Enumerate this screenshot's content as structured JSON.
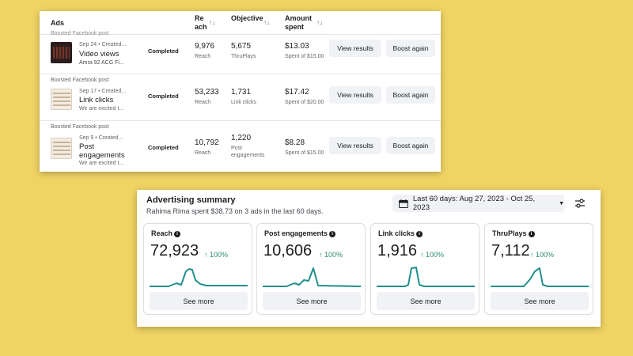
{
  "ads_table": {
    "headers": {
      "ads": "Ads",
      "reach": "Reach",
      "objective": "Objective",
      "amount_spent": "Amount spent"
    },
    "rows": [
      {
        "post_type": "Boosted Facebook post",
        "date": "Sep 24 • Created...",
        "title": "Video views",
        "description": "Amra 92 ACG Fi...",
        "status": "Completed",
        "reach": "9,976",
        "reach_sub": "Reach",
        "objective": "5,675",
        "objective_sub": "ThruPlays",
        "spent": "$13.03",
        "spent_sub": "Spent of $15.00",
        "view_label": "View results",
        "boost_label": "Boost again"
      },
      {
        "post_type": "Boosted Facebook post",
        "date": "Sep 17 • Created...",
        "title": "Link clicks",
        "description": "We are excited t...",
        "status": "Completed",
        "reach": "53,233",
        "reach_sub": "Reach",
        "objective": "1,731",
        "objective_sub": "Link clicks",
        "spent": "$17.42",
        "spent_sub": "Spent of $20.00",
        "view_label": "View results",
        "boost_label": "Boost again"
      },
      {
        "post_type": "Boosted Facebook post",
        "date": "Sep 9 • Created...",
        "title": "Post engagements",
        "description": "We are excited t...",
        "status": "Completed",
        "reach": "10,792",
        "reach_sub": "Reach",
        "objective": "1,220",
        "objective_sub": "Post engagements",
        "spent": "$8.28",
        "spent_sub": "Spent of $15.00",
        "view_label": "View results",
        "boost_label": "Boost again"
      }
    ]
  },
  "summary": {
    "title": "Advertising summary",
    "subtitle": "Rahima Rima spent $38.73 on 3 ads in the last 60 days.",
    "date_range": "Last 60 days: Aug 27, 2023 - Oct 25, 2023",
    "metrics": [
      {
        "label": "Reach",
        "value": "72,923",
        "change": "↑ 100%",
        "see_more": "See more"
      },
      {
        "label": "Post engagements",
        "value": "10,606",
        "change": "↑ 100%",
        "see_more": "See more"
      },
      {
        "label": "Link clicks",
        "value": "1,916",
        "change": "↑ 100%",
        "see_more": "See more"
      },
      {
        "label": "ThruPlays",
        "value": "7,112",
        "change": "↑ 100%",
        "see_more": "See more"
      }
    ]
  },
  "colors": {
    "background": "#efd363",
    "trend_line": "#1f8f8c",
    "change_green": "#2d8a6b"
  }
}
